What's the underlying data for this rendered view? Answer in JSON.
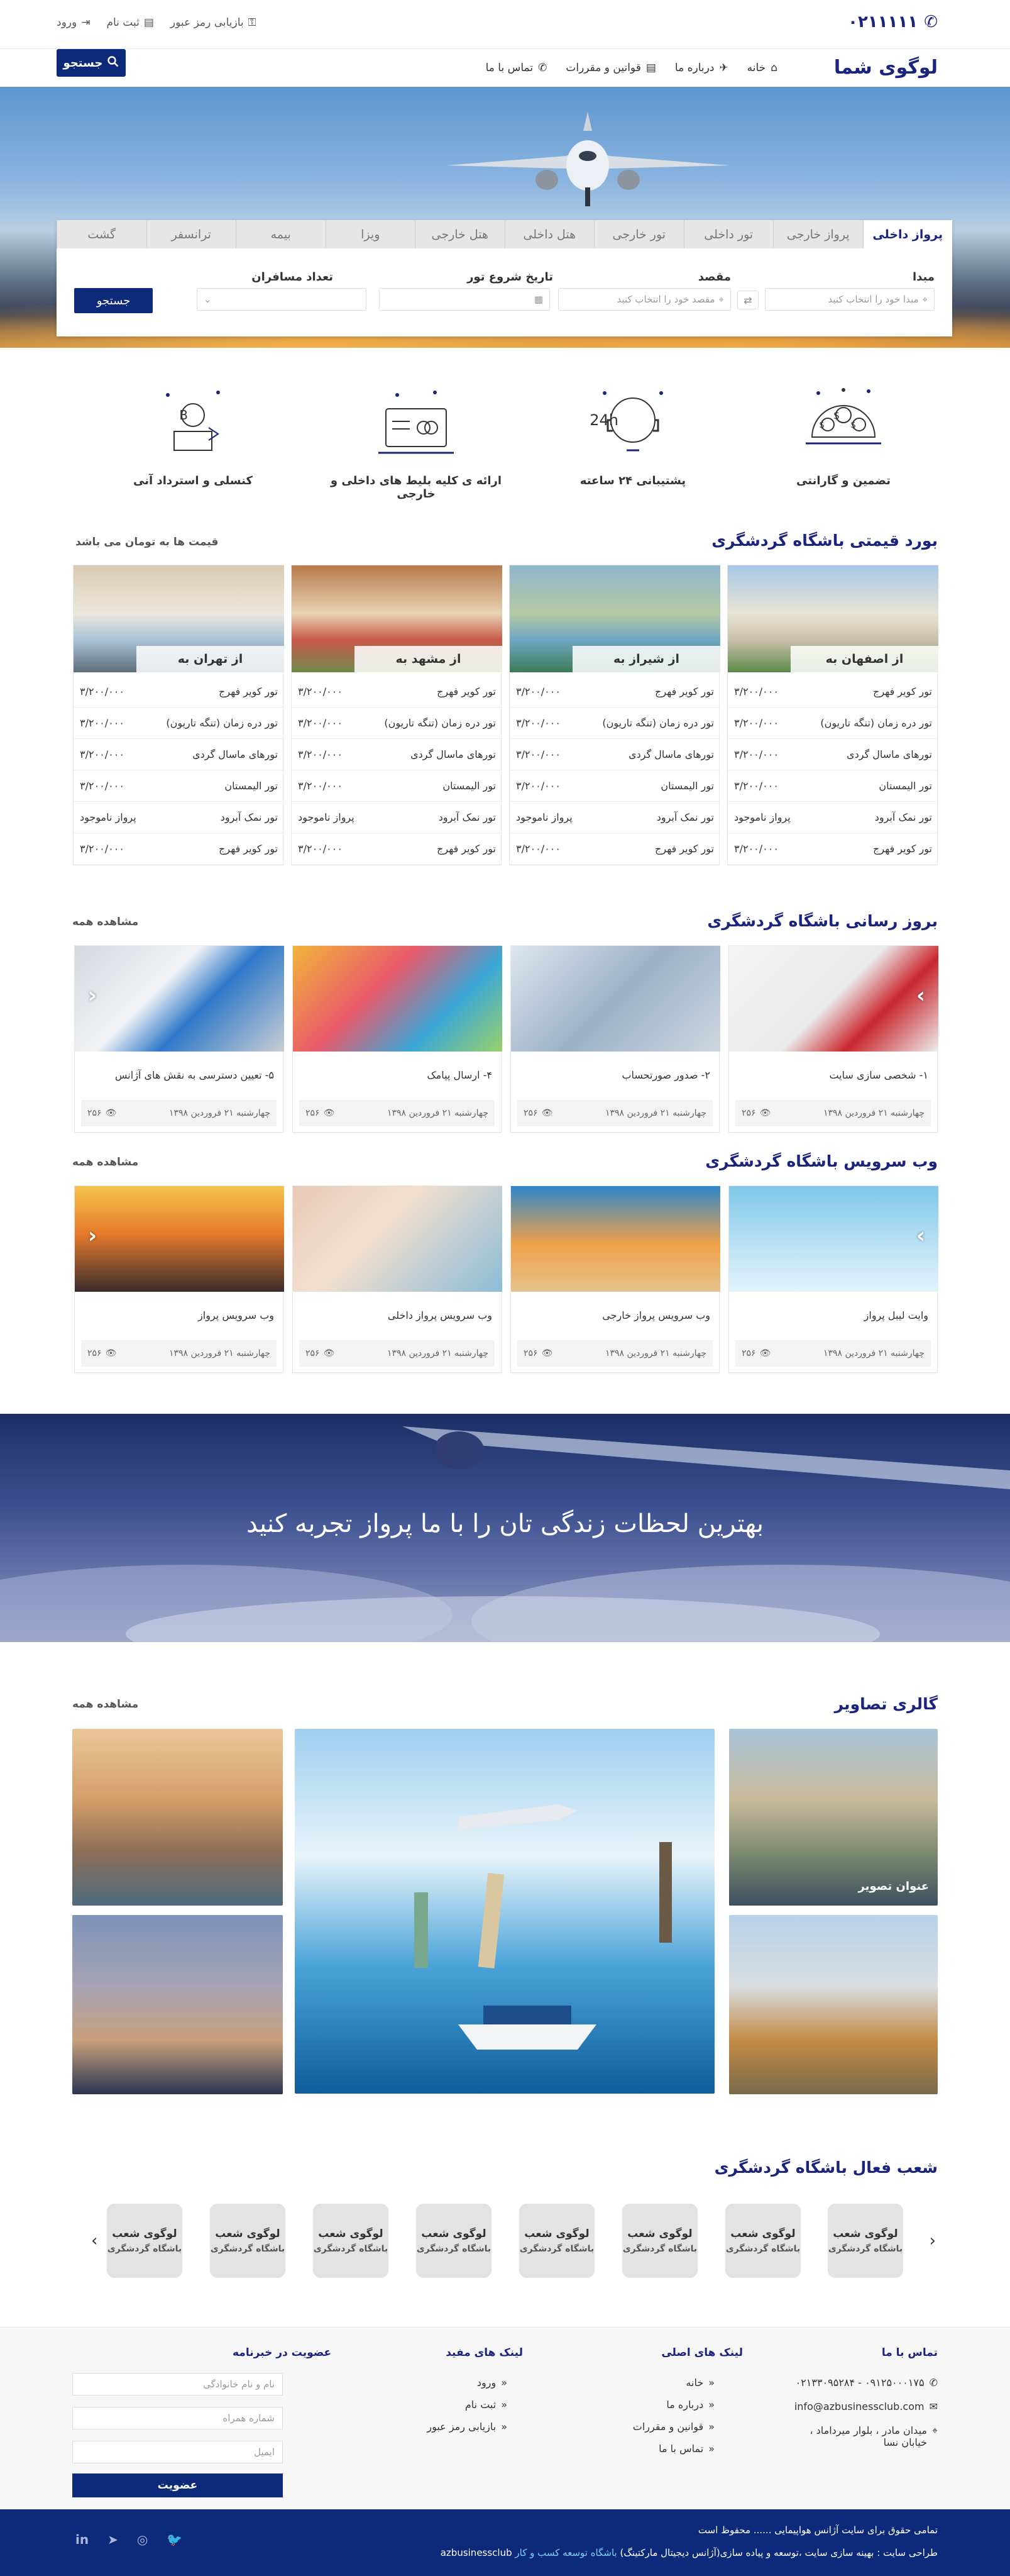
{
  "topbar": {
    "phone": "۰۲۱۱۱۱۱",
    "login": "ورود",
    "register": "ثبت نام",
    "recover": "بازیابی رمز عبور"
  },
  "header": {
    "logo": "لوگوی شما",
    "nav": [
      "خانه",
      "درباره ما",
      "قوانین و مقررات",
      "تماس با ما"
    ],
    "search_label": "جستجو"
  },
  "search_panel": {
    "tabs": [
      "پرواز داخلی",
      "پرواز خارجی",
      "تور داخلی",
      "تور خارجی",
      "هتل داخلی",
      "هتل خارجی",
      "ویزا",
      "بیمه",
      "ترانسفر",
      "گشت"
    ],
    "origin_label": "مبدا",
    "origin_placeholder": "مبدا خود را انتخاب کنید",
    "dest_label": "مقصد",
    "dest_placeholder": "مقصد خود را انتخاب کنید",
    "date_label": "تاریخ شروع تور",
    "passengers_label": "تعداد مسافران",
    "submit": "جستجو"
  },
  "features": [
    {
      "icon": "globe-money-icon",
      "label": "تضمین و گارانتی"
    },
    {
      "icon": "support-24h-icon",
      "label": "پشتیبانی ۲۴ ساعته"
    },
    {
      "icon": "tickets-icon",
      "label": "ارائه ی کلیه  بلیط های داخلی و خارجی"
    },
    {
      "icon": "bitcoin-refund-icon",
      "label": "کنسلی و استرداد آنی"
    }
  ],
  "price_board": {
    "title": "بورد قیمتی باشگاه گردشگری",
    "note": "قیمت ها به تومان می باشد",
    "cards": [
      {
        "caption": "از اصفهان به",
        "rows": [
          {
            "name": "تور کویر فهرج",
            "price": "۳/۲۰۰/۰۰۰"
          },
          {
            "name": "تور دره زمان (تنگه تاریون)",
            "price": "۳/۲۰۰/۰۰۰"
          },
          {
            "name": "تورهای ماسال گردی",
            "price": "۳/۲۰۰/۰۰۰"
          },
          {
            "name": "تور الیمستان",
            "price": "۳/۲۰۰/۰۰۰"
          },
          {
            "name": "تور نمک آبرود",
            "price": "پرواز نامو‌جود"
          },
          {
            "name": "تور کویر فهرج",
            "price": "۳/۲۰۰/۰۰۰"
          }
        ]
      },
      {
        "caption": "از شیراز به",
        "rows": [
          {
            "name": "تور کویر فهرج",
            "price": "۳/۲۰۰/۰۰۰"
          },
          {
            "name": "تور دره زمان (تنگه تاریون)",
            "price": "۳/۲۰۰/۰۰۰"
          },
          {
            "name": "تورهای ماسال گردی",
            "price": "۳/۲۰۰/۰۰۰"
          },
          {
            "name": "تور الیمستان",
            "price": "۳/۲۰۰/۰۰۰"
          },
          {
            "name": "تور نمک آبرود",
            "price": "پرواز نامو‌جود"
          },
          {
            "name": "تور کویر فهرج",
            "price": "۳/۲۰۰/۰۰۰"
          }
        ]
      },
      {
        "caption": "از مشهد به",
        "rows": [
          {
            "name": "تور کویر فهرج",
            "price": "۳/۲۰۰/۰۰۰"
          },
          {
            "name": "تور دره زمان (تنگه تاریون)",
            "price": "۳/۲۰۰/۰۰۰"
          },
          {
            "name": "تورهای ماسال گردی",
            "price": "۳/۲۰۰/۰۰۰"
          },
          {
            "name": "تور الیمستان",
            "price": "۳/۲۰۰/۰۰۰"
          },
          {
            "name": "تور نمک آبرود",
            "price": "پرواز نامو‌جود"
          },
          {
            "name": "تور کویر فهرج",
            "price": "۳/۲۰۰/۰۰۰"
          }
        ]
      },
      {
        "caption": "از تهران به",
        "rows": [
          {
            "name": "تور کویر فهرج",
            "price": "۳/۲۰۰/۰۰۰"
          },
          {
            "name": "تور دره زمان (تنگه تاریون)",
            "price": "۳/۲۰۰/۰۰۰"
          },
          {
            "name": "تورهای ماسال گردی",
            "price": "۳/۲۰۰/۰۰۰"
          },
          {
            "name": "تور الیمستان",
            "price": "۳/۲۰۰/۰۰۰"
          },
          {
            "name": "تور نمک آبرود",
            "price": "پرواز نامو‌جود"
          },
          {
            "name": "تور کویر فهرج",
            "price": "۳/۲۰۰/۰۰۰"
          }
        ]
      }
    ]
  },
  "news": {
    "title": "بروز رسانی باشگاه گردشگری",
    "see_all": "مشاهده همه",
    "cards": [
      {
        "title": "۱- شخصی سازی سایت",
        "date": "چهارشنبه ۲۱ فروردین ۱۳۹۸",
        "views": "۲۵۶"
      },
      {
        "title": "۲- صدور صورتحساب",
        "date": "چهارشنبه ۲۱ فروردین ۱۳۹۸",
        "views": "۲۵۶"
      },
      {
        "title": "۴- ارسال پیامک",
        "date": "چهارشنبه ۲۱ فروردین ۱۳۹۸",
        "views": "۲۵۶"
      },
      {
        "title": "۵- تعیین دسترسی به نقش های آژانس",
        "date": "چهارشنبه ۲۱ فروردین ۱۳۹۸",
        "views": "۲۵۶"
      }
    ]
  },
  "services": {
    "title": "وب سرویس باشگاه گردشگری",
    "see_all": "مشاهده همه",
    "cards": [
      {
        "title": "وایت لیبل پرواز",
        "date": "چهارشنبه ۲۱ فروردین ۱۳۹۸",
        "views": "۲۵۶"
      },
      {
        "title": "وب سرویس پرواز خارجی",
        "date": "چهارشنبه ۲۱ فروردین ۱۳۹۸",
        "views": "۲۵۶"
      },
      {
        "title": "وب سرویس پرواز داخلی",
        "date": "چهارشنبه ۲۱ فروردین ۱۳۹۸",
        "views": "۲۵۶"
      },
      {
        "title": "وب سرویس پرواز",
        "date": "چهارشنبه ۲۱ فروردین ۱۳۹۸",
        "views": "۲۵۶"
      }
    ]
  },
  "banner": {
    "text": "بهترین لحظات زندگی تان را با ما پرواز تجربه کنید"
  },
  "gallery": {
    "title": "گالری تصاویر",
    "see_all": "مشاهده همه",
    "caption": "عنوان تصویر"
  },
  "branches": {
    "title": "شعب فعال باشگاه گردشگری",
    "items": [
      {
        "l1": "لوگوی شعب",
        "l2": "باشگاه گردشگری"
      },
      {
        "l1": "لوگوی شعب",
        "l2": "باشگاه گردشگری"
      },
      {
        "l1": "لوگوی شعب",
        "l2": "باشگاه گردشگری"
      },
      {
        "l1": "لوگوی شعب",
        "l2": "باشگاه گردشگری"
      },
      {
        "l1": "لوگوی شعب",
        "l2": "باشگاه گردشگری"
      },
      {
        "l1": "لوگوی شعب",
        "l2": "باشگاه گردشگری"
      },
      {
        "l1": "لوگوی شعب",
        "l2": "باشگاه گردشگری"
      },
      {
        "l1": "لوگوی شعب",
        "l2": "باشگاه گردشگری"
      }
    ]
  },
  "footer": {
    "contact_title": "تماس با ما",
    "phones": "۰۹۱۲۵۰۰۰۱۷۵ - ۰۲۱۳۳۰۹۵۲۸۴",
    "email": "info@azbusinessclub.com",
    "address": "میدان مادر ، بلوار میرداماد ، خیابان نسا",
    "main_links_title": "لینک های اصلی",
    "main_links": [
      "خانه",
      "درباره ما",
      "قوانین و مقررات",
      "تماس با ما"
    ],
    "useful_links_title": "لینک های مفید",
    "useful_links": [
      "ورود",
      "ثبت نام",
      "بازیابی رمز عبور"
    ],
    "newsletter_title": "عضویت در خبرنامه",
    "newsletter_fields": [
      "نام و نام خانوادگی",
      "شماره همراه",
      "ایمیل"
    ],
    "newsletter_submit": "عضویت"
  },
  "copyright": {
    "line1": "تمامی حقوق برای سایت آژانس هواپیمایی ...... محفوظ است",
    "line2": "طراحی سایت : بهینه سازی سایت ،توسعه و پیاده سازی(آژانس دیجیتال مارکتینگ)",
    "line2_highlight": "باشگاه توسعه کسب و کار",
    "line2_domain": "azbusinessclub"
  },
  "colors": {
    "brand": "#1a237e",
    "button": "#0d2a7a",
    "price": "#2ea043"
  }
}
